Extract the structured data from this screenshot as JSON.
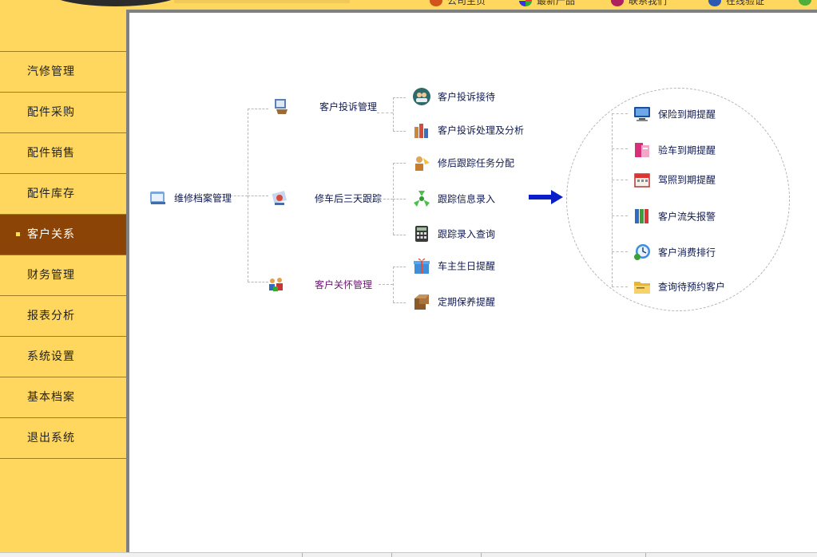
{
  "header": {
    "links": [
      {
        "label": "公司主页",
        "icon": "home-icon"
      },
      {
        "label": "最新产品",
        "icon": "product-icon"
      },
      {
        "label": "联系我们",
        "icon": "contact-icon"
      },
      {
        "label": "在线验证",
        "icon": "verify-icon"
      }
    ]
  },
  "sidebar": {
    "items": [
      {
        "label": "汽修管理"
      },
      {
        "label": "配件采购"
      },
      {
        "label": "配件销售"
      },
      {
        "label": "配件库存"
      },
      {
        "label": "客户关系",
        "active": true
      },
      {
        "label": "财务管理"
      },
      {
        "label": "报表分析"
      },
      {
        "label": "系统设置"
      },
      {
        "label": "基本档案"
      },
      {
        "label": "退出系统"
      }
    ]
  },
  "diagram": {
    "root": {
      "label": "维修档案管理",
      "icon": "archive-icon"
    },
    "groups": [
      {
        "label": "客户投诉管理",
        "icon": "complaint-icon"
      },
      {
        "label": "修车后三天跟踪",
        "icon": "tracking-icon"
      },
      {
        "label": "客户关怀管理",
        "icon": "care-icon"
      }
    ],
    "leaves": [
      {
        "label": "客户投诉接待",
        "icon": "reception-icon"
      },
      {
        "label": "客户投诉处理及分析",
        "icon": "analysis-icon"
      },
      {
        "label": "修后跟踪任务分配",
        "icon": "assign-icon"
      },
      {
        "label": "跟踪信息录入",
        "icon": "entry-icon"
      },
      {
        "label": "跟踪录入查询",
        "icon": "calculator-icon"
      },
      {
        "label": "车主生日提醒",
        "icon": "gift-icon"
      },
      {
        "label": "定期保养提醒",
        "icon": "maintenance-icon"
      }
    ],
    "reminders": [
      {
        "label": "保险到期提醒",
        "icon": "computer-icon"
      },
      {
        "label": "验车到期提醒",
        "icon": "inspection-icon"
      },
      {
        "label": "驾照到期提醒",
        "icon": "calendar-icon"
      },
      {
        "label": "客户流失报警",
        "icon": "binders-icon"
      },
      {
        "label": "客户消费排行",
        "icon": "clock-icon"
      },
      {
        "label": "查询待预约客户",
        "icon": "folder-icon"
      }
    ]
  },
  "colors": {
    "sidebar_bg": "#ffd75e",
    "sidebar_active": "#8b4406",
    "group_purple": "#6b1670",
    "arrow_blue": "#0a1ec8"
  }
}
